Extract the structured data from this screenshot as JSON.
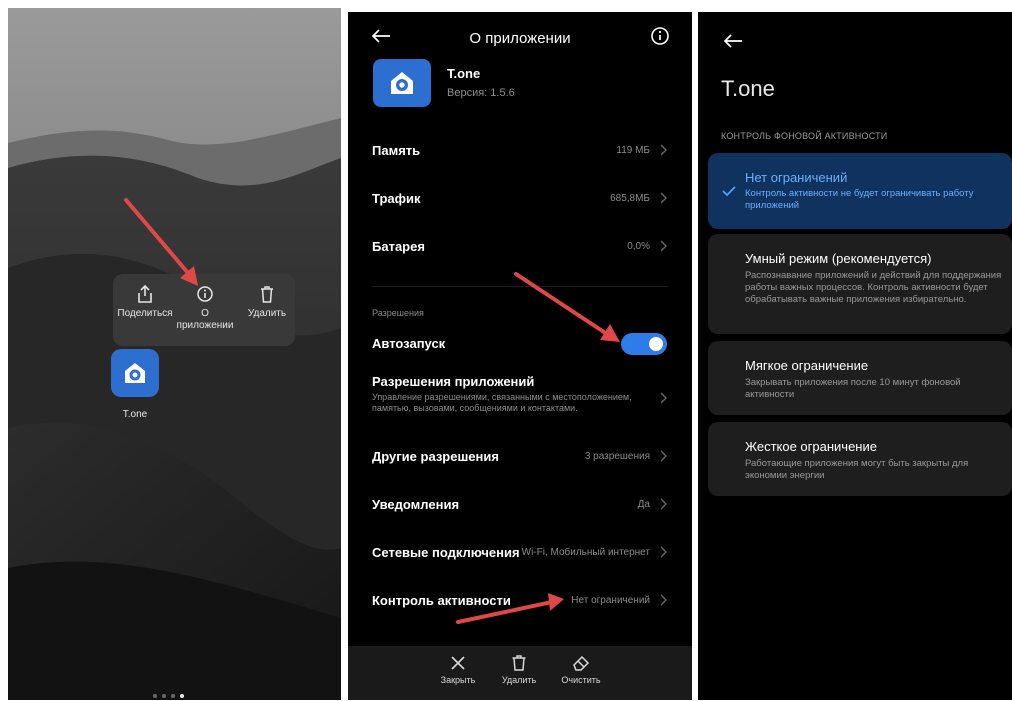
{
  "panel1": {
    "popup": {
      "share_label": "Поделиться",
      "info_label_line1": "О",
      "info_label_line2": "приложении",
      "delete_label": "Удалить"
    },
    "app_name": "T.one",
    "page_indicator": {
      "total": 4,
      "active_index": 3
    }
  },
  "panel2": {
    "header": {
      "title": "О приложении",
      "back_icon": "arrow-left-icon",
      "info_icon": "info-icon"
    },
    "app": {
      "name": "T.one",
      "version": "Версия: 1.5.6"
    },
    "rows": {
      "memory": {
        "title": "Память",
        "value": "119 МБ"
      },
      "traffic": {
        "title": "Трафик",
        "value": "685,8МБ"
      },
      "battery": {
        "title": "Батарея",
        "value": "0,0%"
      },
      "permissions_section": "Разрешения",
      "autostart": {
        "title": "Автозапуск",
        "enabled": true
      },
      "app_permissions": {
        "title": "Разрешения приложений",
        "subtitle": "Управление разрешениями, связанными с местоположением, памятью, вызовами, сообщениями и контактами."
      },
      "other_permissions": {
        "title": "Другие разрешения",
        "value": "3 разрешения"
      },
      "notifications": {
        "title": "Уведомления",
        "value": "Да"
      },
      "network": {
        "title": "Сетевые подключения",
        "value": "Wi-Fi, Мобильный интернет"
      },
      "activity_control": {
        "title": "Контроль активности",
        "value": "Нет ограничений"
      }
    },
    "bottom_bar": {
      "close_label": "Закрыть",
      "delete_label": "Удалить",
      "clear_label": "Очистить"
    }
  },
  "panel3": {
    "title": "T.one",
    "section": "КОНТРОЛЬ ФОНОВОЙ АКТИВНОСТИ",
    "options": [
      {
        "title": "Нет ограничений",
        "desc": "Контроль активности не будет ограничивать работу приложений",
        "selected": true
      },
      {
        "title": "Умный режим (рекомендуется)",
        "desc": "Распознавание приложений и действий для поддержания работы важных процессов. Контроль активности будет обрабатывать важные приложения избирательно.",
        "selected": false
      },
      {
        "title": "Мягкое ограничение",
        "desc": "Закрывать приложения после 10 минут фоновой активности",
        "selected": false
      },
      {
        "title": "Жесткое ограничение",
        "desc": "Работающие приложения могут быть закрыты для экономии энергии",
        "selected": false
      }
    ]
  },
  "colors": {
    "accent": "#2e7bea",
    "arrow": "#e04848",
    "selected_card": "#10325e",
    "card": "#1e1e1e"
  }
}
